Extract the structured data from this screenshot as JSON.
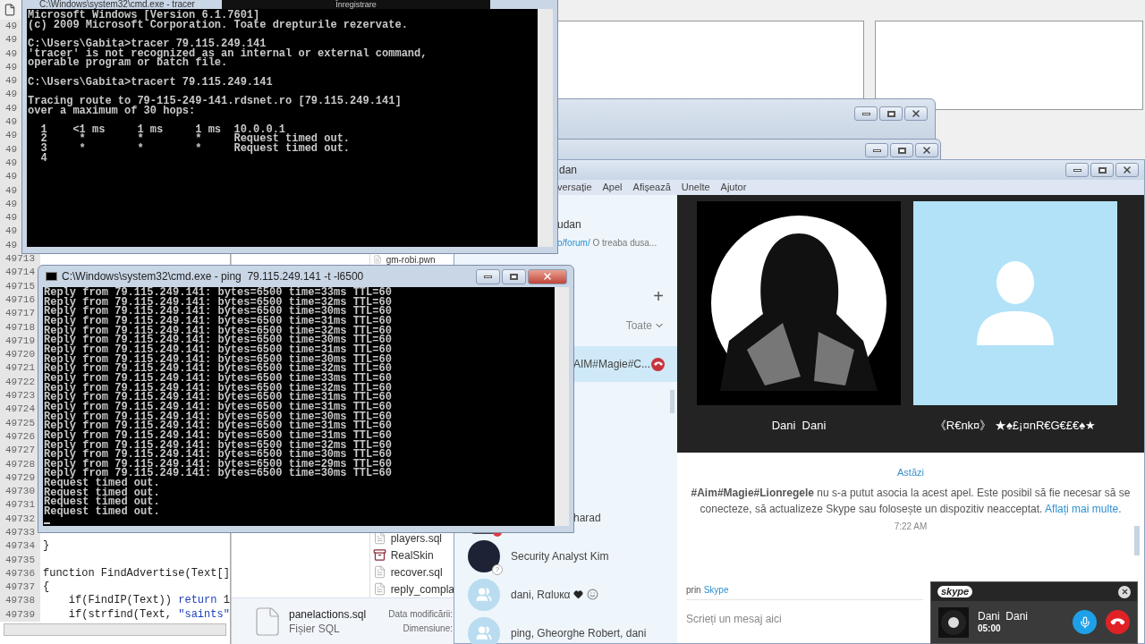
{
  "recording_bar": {
    "label": "Înregistrare"
  },
  "code_editor": {
    "gutter": [
      {
        "number": "49"
      },
      {
        "number": "49"
      },
      {
        "number": "49"
      },
      {
        "number": "49"
      },
      {
        "number": "49"
      },
      {
        "number": "49"
      },
      {
        "number": "49"
      },
      {
        "number": "49"
      },
      {
        "number": "49"
      },
      {
        "number": "49"
      },
      {
        "number": "49"
      },
      {
        "number": "49"
      },
      {
        "number": "49"
      },
      {
        "number": "49"
      },
      {
        "number": "49"
      },
      {
        "number": "49"
      },
      {
        "number": "49"
      },
      {
        "number": "49713"
      },
      {
        "number": "49714"
      },
      {
        "number": "49715"
      },
      {
        "number": "49716"
      },
      {
        "number": "49717"
      },
      {
        "number": "49718"
      },
      {
        "number": "49719"
      },
      {
        "number": "49720"
      },
      {
        "number": "49721"
      },
      {
        "number": "49722"
      },
      {
        "number": "49723"
      },
      {
        "number": "49724"
      },
      {
        "number": "49725"
      },
      {
        "number": "49726"
      },
      {
        "number": "49727"
      },
      {
        "number": "49728"
      },
      {
        "number": "49729"
      },
      {
        "number": "49730"
      },
      {
        "number": "49731"
      },
      {
        "number": "49732"
      },
      {
        "number": "49733"
      },
      {
        "number": "49734",
        "code": [
          {
            "text": "}",
            "kind": "plain"
          }
        ]
      },
      {
        "number": "49735"
      },
      {
        "number": "49736",
        "code": [
          {
            "text": "function FindAdvertise(Text[]",
            "kind": "plain"
          }
        ]
      },
      {
        "number": "49737",
        "code": [
          {
            "text": "{",
            "kind": "plain"
          }
        ]
      },
      {
        "number": "49738",
        "code": [
          {
            "text": "    if(FindIP(Text)) ",
            "kind": "plain"
          },
          {
            "text": "return",
            "kind": "keyword"
          },
          {
            "text": " 1",
            "kind": "plain"
          }
        ]
      },
      {
        "number": "49739",
        "code": [
          {
            "text": "    if(strfind(Text, ",
            "kind": "plain"
          },
          {
            "text": "\"saints\"",
            "kind": "string"
          }
        ]
      }
    ]
  },
  "explorer": {
    "files": [
      {
        "name": "gm-robi.pwn",
        "kind": "file"
      },
      {
        "name": "players.sql",
        "kind": "file"
      },
      {
        "name": "RealSkin",
        "kind": "archive"
      },
      {
        "name": "recover.sql",
        "kind": "file"
      },
      {
        "name": "reply_compla",
        "kind": "file"
      }
    ],
    "details": {
      "name": "panelactions.sql",
      "type": "Fișier SQL",
      "fields": [
        "Data modificării:",
        "Dimensiune:"
      ]
    }
  },
  "skype": {
    "title": "dan",
    "menu": [
      "versație",
      "Apel",
      "Afișează",
      "Unelte",
      "Ajutor"
    ],
    "profile": {
      "name": "udan",
      "mood_link": "o/forum/",
      "mood": "O treaba dusa..."
    },
    "add": "+",
    "filter": "Toate",
    "recent": [
      {
        "name": "AIM#Magie#C...",
        "selected": true,
        "in_call": true
      },
      {
        "name": "harad",
        "selected": false,
        "in_call": false,
        "kind": "photo_cut",
        "busy": true,
        "heart": false
      },
      {
        "name": "Security Analyst Kim",
        "selected": false,
        "in_call": false,
        "kind": "photo",
        "busy": false,
        "heart": false,
        "badge": "?"
      },
      {
        "name": "dani, Rαlυкα",
        "selected": false,
        "in_call": false,
        "kind": "group",
        "busy": false,
        "heart": true
      },
      {
        "name": "ping, Gheorghe Robert, dani",
        "selected": false,
        "in_call": false,
        "kind": "group",
        "busy": false,
        "heart": false
      }
    ],
    "call": {
      "participants": [
        {
          "name": "Dani  Dani",
          "kind": "drawing"
        },
        {
          "name": "《R€nk¤》 ★♠£¡¤nR€G€£€♠★",
          "kind": "default"
        }
      ]
    },
    "chat": {
      "date": "Astăzi",
      "message": "**#Aim#Magie#Lionregele** nu s-a putut asocia la acest apel. Este posibil să fie necesar să se conecteze, să actualizeze Skype sau folosește un dispozitiv neacceptat.",
      "link": "Aflați mai multe.",
      "time": "7:22 AM",
      "via": "prin",
      "via_link": "Skype",
      "placeholder": "Scrieți un mesaj aici"
    },
    "mini_call": {
      "logo": "skype",
      "name": "Dani  Dani",
      "duration": "05:00"
    }
  },
  "cmd_trace": {
    "title": "C:\\Windows\\system32\\cmd.exe - tracer",
    "blocks": [
      [
        "Microsoft Windows [Version 6.1.7601]",
        "(c) 2009 Microsoft Corporation. Toate drepturile rezervate."
      ],
      [
        "C:\\Users\\Gabita>tracer 79.115.249.141",
        "'tracer' is not recognized as an internal or external command,",
        "operable program or batch file."
      ],
      [
        "C:\\Users\\Gabita>tracert 79.115.249.141"
      ],
      [
        "Tracing route to 79-115-249-141.rdsnet.ro [79.115.249.141]",
        "over a maximum of 30 hops:"
      ],
      [
        "  1    <1 ms     1 ms     1 ms  10.0.0.1",
        "  2     *        *        *     Request timed out.",
        "  3     *        *        *     Request timed out.",
        "  4"
      ]
    ]
  },
  "cmd_ping": {
    "title": "C:\\Windows\\system32\\cmd.exe - ping  79.115.249.141 -t -l6500",
    "lines": [
      "Reply from 79.115.249.141: bytes=6500 time=33ms TTL=60",
      "Reply from 79.115.249.141: bytes=6500 time=32ms TTL=60",
      "Reply from 79.115.249.141: bytes=6500 time=30ms TTL=60",
      "Reply from 79.115.249.141: bytes=6500 time=31ms TTL=60",
      "Reply from 79.115.249.141: bytes=6500 time=32ms TTL=60",
      "Reply from 79.115.249.141: bytes=6500 time=30ms TTL=60",
      "Reply from 79.115.249.141: bytes=6500 time=31ms TTL=60",
      "Reply from 79.115.249.141: bytes=6500 time=30ms TTL=60",
      "Reply from 79.115.249.141: bytes=6500 time=32ms TTL=60",
      "Reply from 79.115.249.141: bytes=6500 time=33ms TTL=60",
      "Reply from 79.115.249.141: bytes=6500 time=32ms TTL=60",
      "Reply from 79.115.249.141: bytes=6500 time=31ms TTL=60",
      "Reply from 79.115.249.141: bytes=6500 time=31ms TTL=60",
      "Reply from 79.115.249.141: bytes=6500 time=30ms TTL=60",
      "Reply from 79.115.249.141: bytes=6500 time=31ms TTL=60",
      "Reply from 79.115.249.141: bytes=6500 time=31ms TTL=60",
      "Reply from 79.115.249.141: bytes=6500 time=32ms TTL=60",
      "Reply from 79.115.249.141: bytes=6500 time=30ms TTL=60",
      "Reply from 79.115.249.141: bytes=6500 time=29ms TTL=60",
      "Reply from 79.115.249.141: bytes=6500 time=30ms TTL=60",
      "Request timed out.",
      "Request timed out.",
      "Request timed out.",
      "Request timed out."
    ]
  }
}
